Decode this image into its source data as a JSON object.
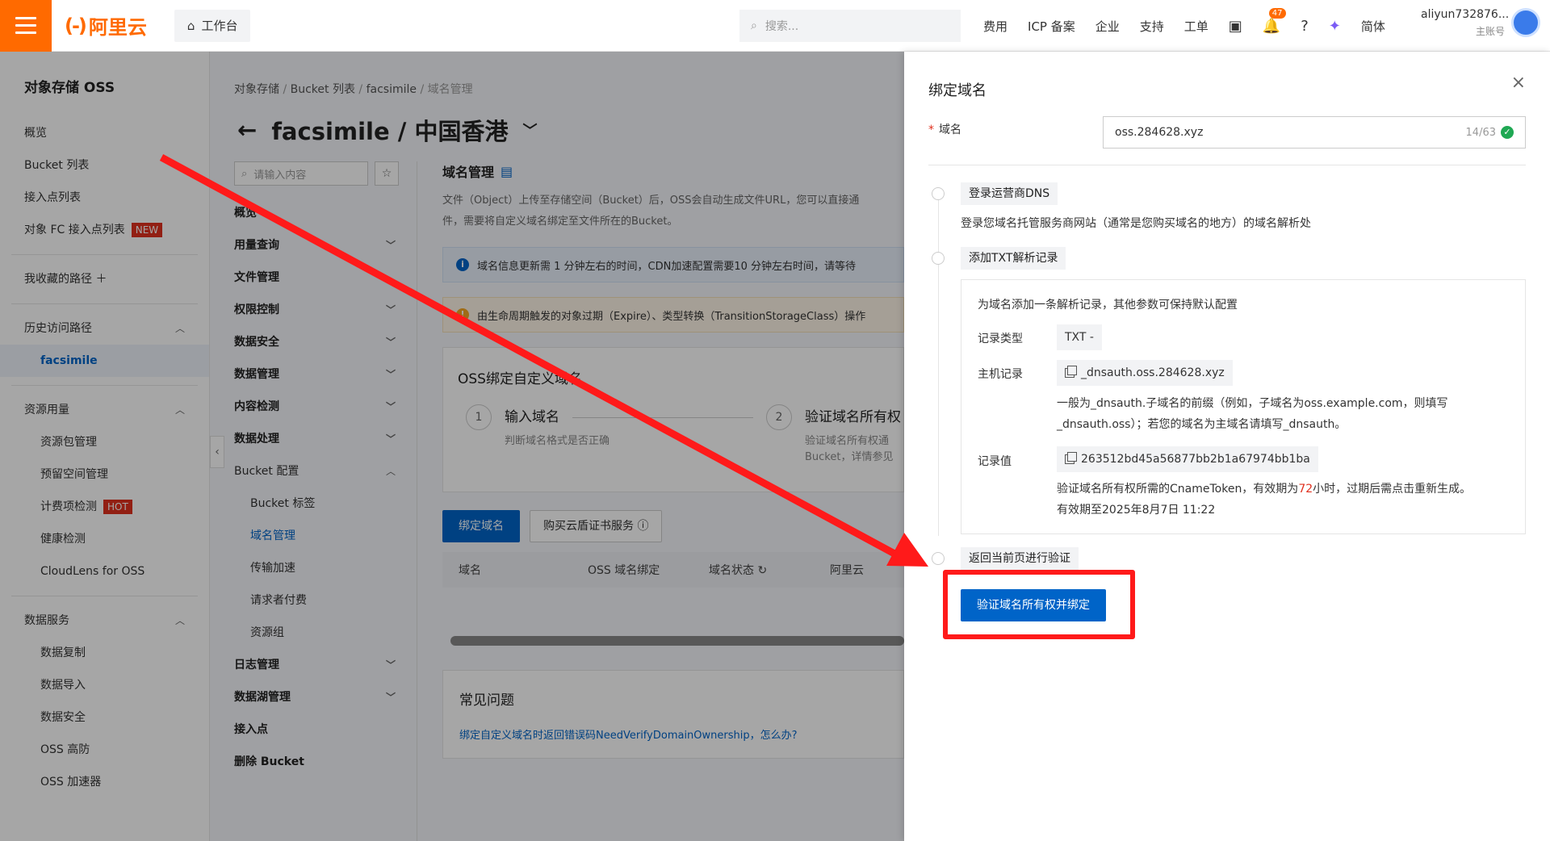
{
  "topbar": {
    "logo_text": "阿里云",
    "workbench": "工作台",
    "search_placeholder": "搜索...",
    "nav": [
      "费用",
      "ICP 备案",
      "企业",
      "支持",
      "工单"
    ],
    "notification_count": "47",
    "lang": "简体",
    "user_name": "aliyun732876...",
    "user_role": "主账号",
    "accent_color": "#ff6a00"
  },
  "sidebar": {
    "title": "对象存储 OSS",
    "items": [
      {
        "label": "概览"
      },
      {
        "label": "Bucket 列表"
      },
      {
        "label": "接入点列表"
      },
      {
        "label": "对象 FC 接入点列表",
        "tag": "NEW"
      }
    ],
    "favorites": "我收藏的路径",
    "history_title": "历史访问路径",
    "history_item": "facsimile",
    "resource_title": "资源用量",
    "resource_items": [
      {
        "label": "资源包管理"
      },
      {
        "label": "预留空间管理"
      },
      {
        "label": "计费项检测",
        "tag": "HOT"
      },
      {
        "label": "健康检测"
      },
      {
        "label": "CloudLens for OSS"
      }
    ],
    "data_title": "数据服务",
    "data_items": [
      "数据复制",
      "数据导入",
      "数据安全",
      "OSS 高防",
      "OSS 加速器"
    ]
  },
  "main": {
    "breadcrumb": [
      "对象存储",
      "Bucket 列表",
      "facsimile",
      "域名管理"
    ],
    "bucket_title": "facsimile / 中国香港",
    "subsearch_placeholder": "请输入内容",
    "subnav": [
      {
        "label": "概览",
        "type": "bold"
      },
      {
        "label": "用量查询",
        "type": "bold",
        "chev": "down"
      },
      {
        "label": "文件管理",
        "type": "bold"
      },
      {
        "label": "权限控制",
        "type": "bold",
        "chev": "down"
      },
      {
        "label": "数据安全",
        "type": "bold",
        "chev": "down"
      },
      {
        "label": "数据管理",
        "type": "bold",
        "chev": "down"
      },
      {
        "label": "内容检测",
        "type": "bold",
        "chev": "down"
      },
      {
        "label": "数据处理",
        "type": "bold",
        "chev": "down"
      },
      {
        "label": "Bucket 配置",
        "type": "light",
        "chev": "up"
      },
      {
        "label": "Bucket 标签",
        "type": "sub"
      },
      {
        "label": "域名管理",
        "type": "sub-active"
      },
      {
        "label": "传输加速",
        "type": "sub"
      },
      {
        "label": "请求者付费",
        "type": "sub"
      },
      {
        "label": "资源组",
        "type": "sub"
      },
      {
        "label": "日志管理",
        "type": "bold",
        "chev": "down"
      },
      {
        "label": "数据湖管理",
        "type": "bold",
        "chev": "down"
      },
      {
        "label": "接入点",
        "type": "bold"
      },
      {
        "label": "删除 Bucket",
        "type": "bold"
      }
    ],
    "section_title": "域名管理",
    "desc_line1": "文件（Object）上传至存储空间（Bucket）后，OSS会自动生成文件URL，您可以直接通",
    "desc_line2": "件，需要将自定义域名绑定至文件所在的Bucket。",
    "notice_info": "域名信息更新需 1 分钟左右的时间，CDN加速配置需要10 分钟左右时间，请等待",
    "notice_warn": "由生命周期触发的对象过期（Expire）、类型转换（TransitionStorageClass）操作",
    "bind_card_title": "OSS绑定自定义域名",
    "step1_num": "1",
    "step1_title": "输入域名",
    "step1_desc": "判断域名格式是否正确",
    "step2_num": "2",
    "step2_title": "验证域名所有权",
    "step2_desc_1": "验证域名所有权通",
    "step2_desc_2": "Bucket，详情参见",
    "btn_bind": "绑定域名",
    "btn_cert": "购买云盾证书服务",
    "table_headers": [
      "域名",
      "OSS 域名绑定",
      "域名状态",
      "阿里云"
    ],
    "faq_title": "常见问题",
    "faq_link": "绑定自定义域名时返回错误码NeedVerifyDomainOwnership，怎么办?"
  },
  "drawer": {
    "title": "绑定域名",
    "domain_label": "域名",
    "domain_value": "oss.284628.xyz",
    "counter": "14/63",
    "step1_tag": "登录运营商DNS",
    "step1_desc": "登录您域名托管服务商网站（通常是您购买域名的地方）的域名解析处",
    "step2_tag": "添加TXT解析记录",
    "txt_intro": "为域名添加一条解析记录，其他参数可保持默认配置",
    "record_type_label": "记录类型",
    "record_type_value": "TXT -",
    "host_label": "主机记录",
    "host_value": "_dnsauth.oss.284628.xyz",
    "host_note_1": "一般为_dnsauth.子域名的前缀（例如，子域名为oss.example.com，则填写",
    "host_note_2": "_dnsauth.oss）；若您的域名为主域名请填写_dnsauth。",
    "value_label": "记录值",
    "value_value": "263512bd45a56877bb2b1a67974bb1ba",
    "value_note_1a": "验证域名所有权所需的CnameToken，有效期为",
    "value_note_hl": "72",
    "value_note_1b": "小时，过期后需点击重新生成。",
    "value_note_2": "有效期至2025年8月7日 11:22",
    "step3_tag": "返回当前页进行验证",
    "verify_btn": "验证域名所有权并绑定"
  },
  "annotation": {
    "arrow_color": "#ff1a1a"
  }
}
